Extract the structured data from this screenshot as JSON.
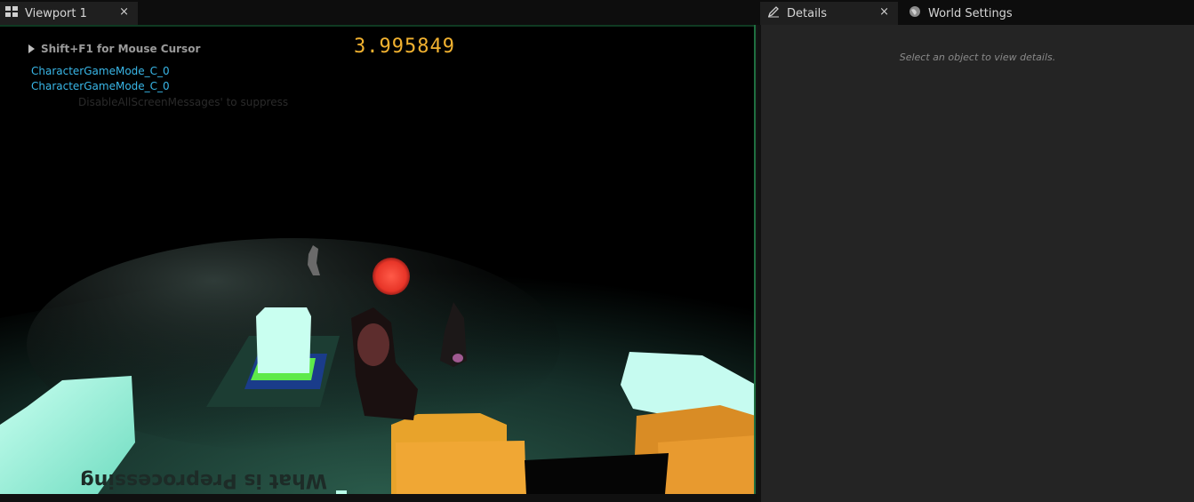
{
  "tabs": {
    "viewport": {
      "label": "Viewport 1",
      "close": "×"
    },
    "details": {
      "label": "Details",
      "close": "×"
    },
    "world_settings": {
      "label": "World Settings"
    }
  },
  "viewport": {
    "hud_hint": "Shift+F1 for Mouse Cursor",
    "messages": [
      "CharacterGameMode_C_0",
      "CharacterGameMode_C_0"
    ],
    "suppress_text": "DisableAllScreenMessages' to suppress",
    "counter": "3.995849",
    "floor_text": "What is Preprocessing"
  },
  "details": {
    "empty_text": "Select an object to view details."
  },
  "colors": {
    "hud_number": "#f2b230",
    "hud_message": "#39b7e8",
    "viewport_border": "#1f6e40",
    "panel_bg": "#242424"
  }
}
